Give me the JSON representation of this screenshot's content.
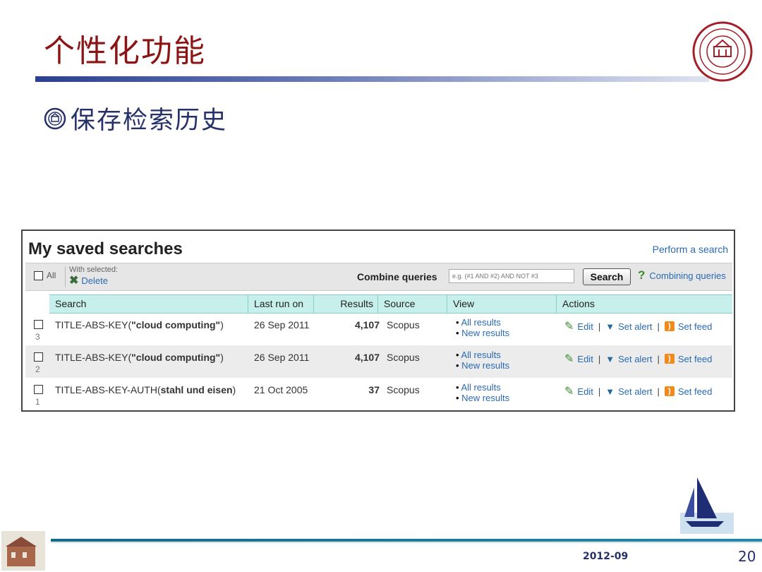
{
  "slide": {
    "title": "个性化功能",
    "subtitle": "保存检索历史",
    "date": "2012-09",
    "page_number": "20",
    "colors": {
      "title": "#8b1414",
      "subtitle": "#26306b",
      "link": "#2a6ab1",
      "header_bg": "#c7efeb"
    }
  },
  "panel": {
    "heading": "My saved searches",
    "perform_link": "Perform a search",
    "toolbar": {
      "all_label": "All",
      "with_selected": "With selected:",
      "delete_label": "Delete",
      "combine_label": "Combine queries",
      "combine_placeholder": "e.g. (#1 AND #2) AND NOT #3",
      "search_button": "Search",
      "help_label": "Combining queries"
    },
    "columns": [
      "Search",
      "Last run on",
      "Results",
      "Source",
      "View",
      "Actions"
    ],
    "rows": [
      {
        "num": "3",
        "prefix": "TITLE-ABS-KEY(",
        "term": "\"cloud computing\"",
        "suffix": ")",
        "date": "26 Sep 2011",
        "results": "4,107",
        "source": "Scopus"
      },
      {
        "num": "2",
        "prefix": "TITLE-ABS-KEY(",
        "term": "\"cloud computing\"",
        "suffix": ")",
        "date": "26 Sep 2011",
        "results": "4,107",
        "source": "Scopus"
      },
      {
        "num": "1",
        "prefix": "TITLE-ABS-KEY-AUTH(",
        "term": "stahl und eisen",
        "suffix": ")",
        "date": "21 Oct 2005",
        "results": "37",
        "source": "Scopus"
      }
    ],
    "view_links": {
      "all": "All results",
      "new": "New results"
    },
    "actions": {
      "edit": "Edit",
      "alert": "Set alert",
      "feed": "Set feed",
      "separator": "|"
    }
  },
  "icons": {
    "logo": "university-seal-icon",
    "bullet": "seal-bullet-icon",
    "delete": "x-icon",
    "help": "question-icon",
    "edit": "pencil-icon",
    "alert": "bell-icon",
    "feed": "rss-icon",
    "boat": "sailboat-icon"
  }
}
